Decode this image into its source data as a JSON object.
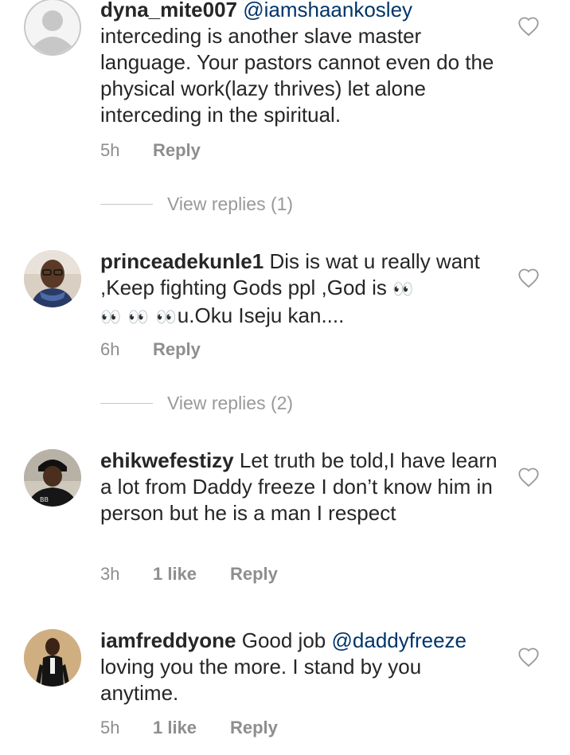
{
  "comments": [
    {
      "username": "dyna_mite007",
      "mention": "@iamshaankosley",
      "text": "interceding is another slave master language. Your pastors cannot even do the physical work(lazy thrives) let alone interceding in the spiritual.",
      "time": "5h",
      "reply_label": "Reply",
      "avatar": "default-avatar-icon",
      "view_replies": "View replies (1)"
    },
    {
      "username": "princeadekunle1",
      "text_part1": "Dis is wat u really want ,Keep fighting Gods ppl ,God is",
      "emoji1": "👀",
      "emoji2": "👀 👀 👀",
      "text_part2": "u.Oku Iseju kan....",
      "time": "6h",
      "reply_label": "Reply",
      "avatar": "user-photo",
      "view_replies": "View replies (2)"
    },
    {
      "username": "ehikwefestizy",
      "text": "Let truth be told,I have learn a lot from Daddy freeze I don’t know him in person but he is a man I respect",
      "time": "3h",
      "likes": "1 like",
      "reply_label": "Reply",
      "avatar": "user-photo"
    },
    {
      "username": "iamfreddyone",
      "text_part1": "Good job",
      "mention": "@daddyfreeze",
      "text_part2": "loving you the more. I stand by you anytime.",
      "time": "5h",
      "likes": "1 like",
      "reply_label": "Reply",
      "avatar": "user-photo"
    }
  ],
  "colors": {
    "text": "#262626",
    "secondary": "#8e8e8e",
    "mention": "#003569",
    "divider": "#c7c7c7"
  },
  "icons": {
    "like": "heart-outline-icon"
  }
}
